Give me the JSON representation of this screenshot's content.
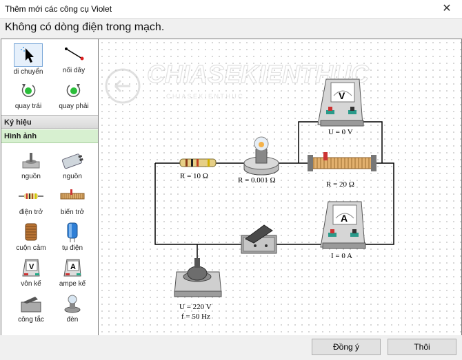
{
  "window": {
    "title": "Thêm mới các công cụ Violet",
    "close_glyph": "✕"
  },
  "status_message": "Không có dòng điện trong mạch.",
  "tools": [
    {
      "label": "di chuyển",
      "icon": "cursor-icon"
    },
    {
      "label": "nối dây",
      "icon": "wire-icon"
    },
    {
      "label": "quay trái",
      "icon": "rotate-left-icon"
    },
    {
      "label": "quay phải",
      "icon": "rotate-right-icon"
    }
  ],
  "sections": {
    "symbols": "Ký hiệu",
    "images": "Hình ảnh"
  },
  "components": [
    {
      "label": "nguồn",
      "icon": "power-source-icon"
    },
    {
      "label": "nguồn",
      "icon": "battery-icon"
    },
    {
      "label": "điện trở",
      "icon": "resistor-icon"
    },
    {
      "label": "biến trở",
      "icon": "rheostat-icon"
    },
    {
      "label": "cuộn cảm",
      "icon": "inductor-icon"
    },
    {
      "label": "tụ điện",
      "icon": "capacitor-icon"
    },
    {
      "label": "vôn kế",
      "icon": "voltmeter-icon"
    },
    {
      "label": "ampe kế",
      "icon": "ammeter-icon"
    },
    {
      "label": "công tắc",
      "icon": "switch-icon"
    },
    {
      "label": "đèn",
      "icon": "lamp-icon"
    }
  ],
  "watermark": {
    "text": "CHIASEKIENTHUC",
    "subtext": "C H I A  S E  K I E N  T H U C"
  },
  "circuit": {
    "resistor_label": "R = 10 Ω",
    "lamp_label": "R = 0.001 Ω",
    "rheostat_label": "R = 20 Ω",
    "voltmeter_label": "U = 0 V",
    "voltmeter_letter": "V",
    "ammeter_label": "I = 0  A",
    "ammeter_letter": "A",
    "source_voltage": "U = 220 V",
    "source_freq": "f = 50 Hz"
  },
  "buttons": {
    "ok": "Đồng ý",
    "close": "Thôi"
  }
}
